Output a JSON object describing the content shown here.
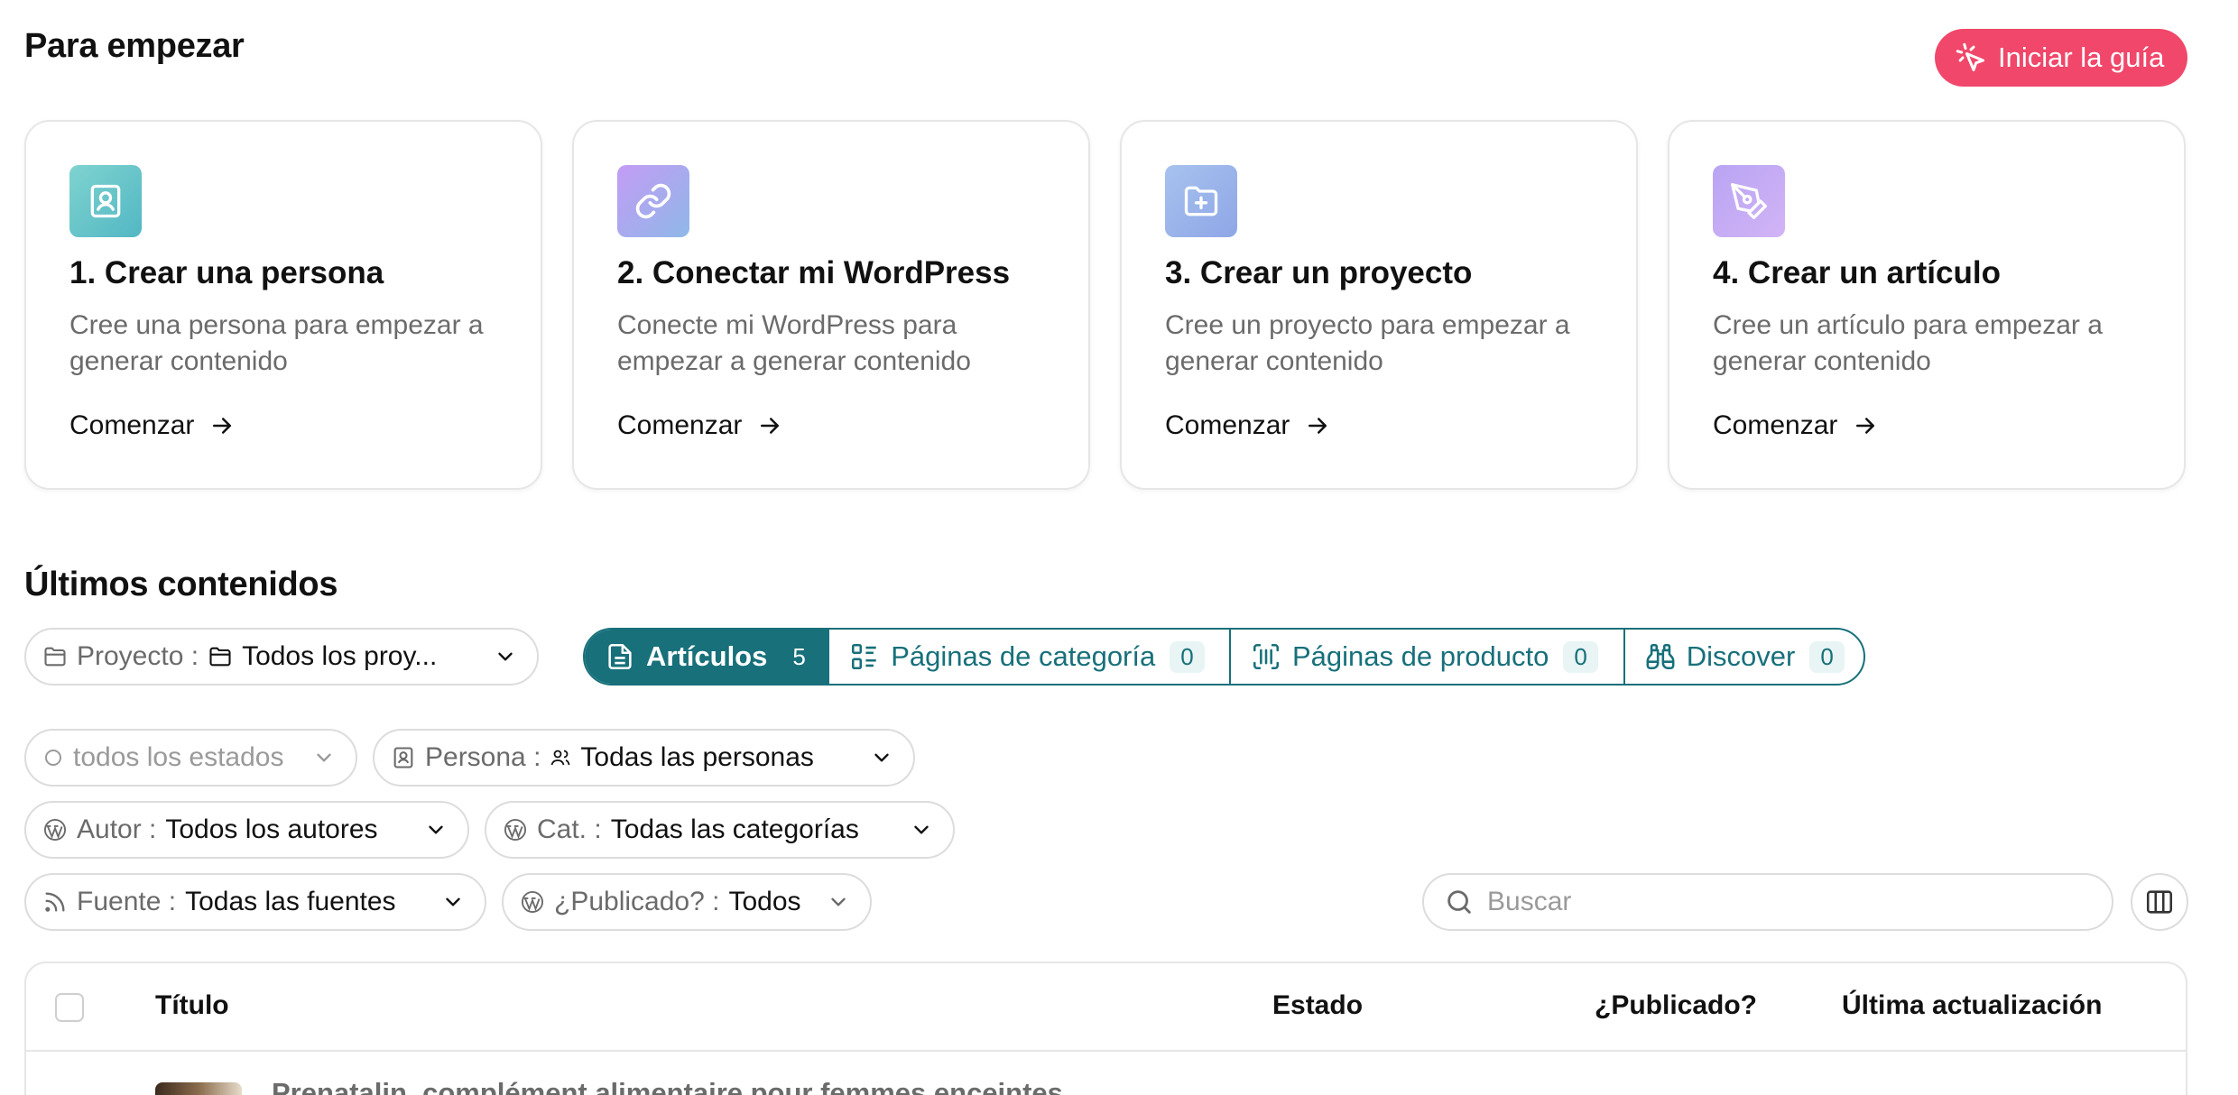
{
  "header": {
    "title": "Para empezar",
    "guide_button": "Iniciar la guía"
  },
  "cards": [
    {
      "title": "1. Crear una persona",
      "desc": "Cree una persona para empezar a generar contenido",
      "link": "Comenzar",
      "icon": "person-card-icon",
      "color": "#5fc1c9"
    },
    {
      "title": "2. Conectar mi WordPress",
      "desc": "Conecte mi WordPress para empezar a generar contenido",
      "link": "Comenzar",
      "icon": "link-icon",
      "color": "#b08ef0"
    },
    {
      "title": "3. Crear un proyecto",
      "desc": "Cree un proyecto para empezar a generar contenido",
      "link": "Comenzar",
      "icon": "folder-plus-icon",
      "color": "#8fb0ea"
    },
    {
      "title": "4. Crear un artículo",
      "desc": "Cree un artículo para empezar a generar contenido",
      "link": "Comenzar",
      "icon": "pen-tool-icon",
      "color": "#bba5f2"
    }
  ],
  "latest": {
    "title": "Últimos contenidos",
    "project_filter": {
      "label": "Proyecto :",
      "value": "Todos los proy..."
    },
    "tabs": [
      {
        "label": "Artículos",
        "count": "5",
        "active": true
      },
      {
        "label": "Páginas de categoría",
        "count": "0"
      },
      {
        "label": "Páginas de producto",
        "count": "0"
      },
      {
        "label": "Discover",
        "count": "0"
      }
    ],
    "filters": {
      "status": {
        "value": "todos los estados"
      },
      "persona": {
        "label": "Persona :",
        "value": "Todas las personas"
      },
      "author": {
        "label": "Autor :",
        "value": "Todos los autores"
      },
      "category": {
        "label": "Cat. :",
        "value": "Todas las categorías"
      },
      "source": {
        "label": "Fuente :",
        "value": "Todas las fuentes"
      },
      "published": {
        "label": "¿Publicado? :",
        "value": "Todos"
      }
    },
    "search": {
      "placeholder": "Buscar"
    }
  },
  "table": {
    "columns": [
      "Título",
      "Estado",
      "¿Publicado?",
      "Última actualización"
    ],
    "rows": [
      {
        "title": "Prenatalin, complément alimentaire pour femmes enceintes"
      }
    ]
  },
  "colors": {
    "accent": "#17707a",
    "brand": "#f0476a"
  }
}
